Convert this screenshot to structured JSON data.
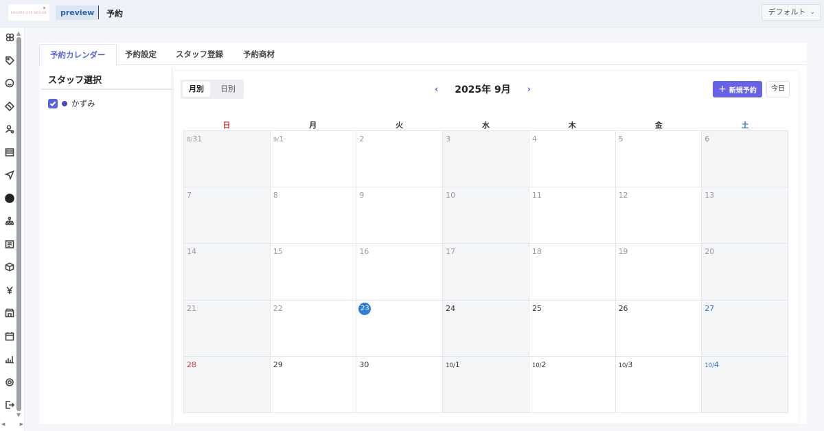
{
  "header": {
    "logo_text": "KAGURA LIFE DESIGN",
    "preview_label": "preview",
    "title": "予約",
    "default_select": "デフォルト"
  },
  "sidebar": {
    "icons": [
      "users-icon",
      "tag-icon",
      "smile-icon",
      "ticket-icon",
      "user-search-icon",
      "list-icon",
      "send-icon",
      "line-icon",
      "hierarchy-icon",
      "document-icon",
      "box-icon",
      "yen-icon",
      "store-icon",
      "calendar-icon",
      "chart-icon",
      "gear-icon",
      "logout-icon"
    ]
  },
  "tabs": [
    {
      "label": "予約カレンダー",
      "active": true
    },
    {
      "label": "予約設定",
      "active": false
    },
    {
      "label": "スタッフ登録",
      "active": false
    },
    {
      "label": "予約商材",
      "active": false
    }
  ],
  "staff": {
    "title": "スタッフ選択",
    "items": [
      {
        "name": "かずみ",
        "checked": true,
        "color": "#4b49c9"
      }
    ]
  },
  "calendar": {
    "view_month": "月別",
    "view_day": "日別",
    "month_label": "2025年 9月",
    "prev": "‹",
    "next": "›",
    "new_label": "新規予約",
    "today_label": "今日",
    "weekdays": [
      "日",
      "月",
      "火",
      "水",
      "木",
      "金",
      "土"
    ],
    "weeks": [
      [
        {
          "p": "8/",
          "d": "31",
          "m": true
        },
        {
          "p": "9/",
          "d": "1",
          "m": true
        },
        {
          "p": "",
          "d": "2",
          "m": true
        },
        {
          "p": "",
          "d": "3",
          "m": true
        },
        {
          "p": "",
          "d": "4",
          "m": true
        },
        {
          "p": "",
          "d": "5",
          "m": true
        },
        {
          "p": "",
          "d": "6",
          "m": true
        }
      ],
      [
        {
          "p": "",
          "d": "7",
          "m": true
        },
        {
          "p": "",
          "d": "8",
          "m": true
        },
        {
          "p": "",
          "d": "9",
          "m": true
        },
        {
          "p": "",
          "d": "10",
          "m": true
        },
        {
          "p": "",
          "d": "11",
          "m": true
        },
        {
          "p": "",
          "d": "12",
          "m": true
        },
        {
          "p": "",
          "d": "13",
          "m": true
        }
      ],
      [
        {
          "p": "",
          "d": "14",
          "m": true
        },
        {
          "p": "",
          "d": "15",
          "m": true
        },
        {
          "p": "",
          "d": "16",
          "m": true
        },
        {
          "p": "",
          "d": "17",
          "m": true
        },
        {
          "p": "",
          "d": "18",
          "m": true
        },
        {
          "p": "",
          "d": "19",
          "m": true
        },
        {
          "p": "",
          "d": "20",
          "m": true
        }
      ],
      [
        {
          "p": "",
          "d": "21",
          "m": true
        },
        {
          "p": "",
          "d": "22",
          "m": true
        },
        {
          "p": "",
          "d": "23",
          "m": false,
          "today": true
        },
        {
          "p": "",
          "d": "24",
          "m": false
        },
        {
          "p": "",
          "d": "25",
          "m": false
        },
        {
          "p": "",
          "d": "26",
          "m": false
        },
        {
          "p": "",
          "d": "27",
          "m": false
        }
      ],
      [
        {
          "p": "",
          "d": "28",
          "m": false
        },
        {
          "p": "",
          "d": "29",
          "m": false
        },
        {
          "p": "",
          "d": "30",
          "m": false
        },
        {
          "p": "10/",
          "d": "1",
          "m": false
        },
        {
          "p": "10/",
          "d": "2",
          "m": false
        },
        {
          "p": "10/",
          "d": "3",
          "m": false
        },
        {
          "p": "10/",
          "d": "4",
          "m": false
        }
      ]
    ],
    "gray_cols": [
      0,
      3,
      6
    ]
  }
}
